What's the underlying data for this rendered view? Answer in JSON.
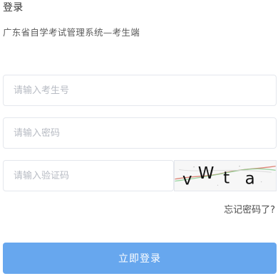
{
  "header": {
    "title": "登录",
    "subtitle": "广东省自学考试管理系统—考生端"
  },
  "form": {
    "candidate_id_placeholder": "请输入考生号",
    "password_placeholder": "请输入密码",
    "captcha_placeholder": "请输入验证码",
    "captcha_text": "vWta",
    "forgot_password": "忘记密码了?",
    "login_button": "立即登录"
  },
  "colors": {
    "primary_button": "#67a7ee",
    "border": "#e4e7ed",
    "placeholder": "#b7bbc3"
  }
}
